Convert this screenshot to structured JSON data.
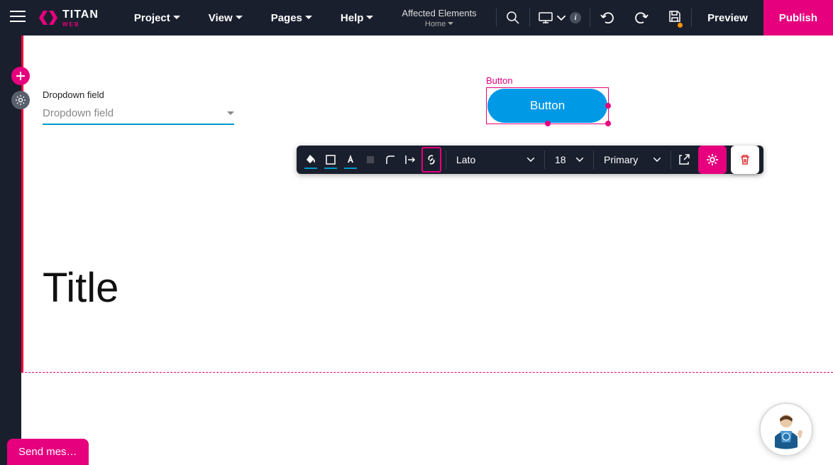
{
  "header": {
    "logo_main": "TITAN",
    "logo_sub": "WEB",
    "menu": {
      "project": "Project",
      "view": "View",
      "pages": "Pages",
      "help": "Help"
    },
    "affected": {
      "title": "Affected Elements",
      "page": "Home"
    },
    "preview": "Preview",
    "publish": "Publish"
  },
  "canvas": {
    "dropdown": {
      "label": "Dropdown field",
      "placeholder": "Dropdown field"
    },
    "button": {
      "tag": "Button",
      "label": "Button"
    },
    "title": "Title"
  },
  "toolbar": {
    "font": "Lato",
    "size": "18",
    "role": "Primary"
  },
  "chat": {
    "label": "Send mes…"
  }
}
